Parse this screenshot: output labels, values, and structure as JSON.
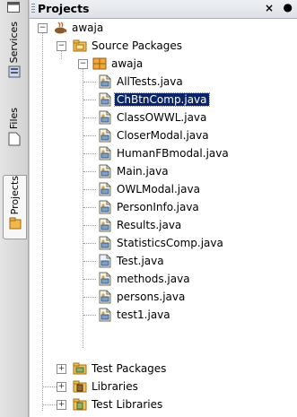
{
  "strip": {
    "tabs": [
      {
        "label": "Services",
        "icon": "services-icon"
      },
      {
        "label": "Files",
        "icon": "files-icon"
      },
      {
        "label": "Projects",
        "icon": "projects-icon"
      }
    ]
  },
  "panel": {
    "title": "Projects",
    "close_label": "×",
    "minimize_label": "●"
  },
  "tree": {
    "project": "awaja",
    "source_packages": "Source Packages",
    "package": "awaja",
    "files": [
      "AllTests.java",
      "ChBtnComp.java",
      "ClassOWWL.java",
      "CloserModal.java",
      "HumanFBmodal.java",
      "Main.java",
      "OWLModal.java",
      "PersonInfo.java",
      "Results.java",
      "StatisticsComp.java",
      "Test.java",
      "methods.java",
      "persons.java",
      "test1.java"
    ],
    "selected_file": "ChBtnComp.java",
    "test_packages": "Test Packages",
    "libraries": "Libraries",
    "test_libraries": "Test Libraries"
  },
  "colors": {
    "selection": "#0a246a",
    "folder": "#e8b34a",
    "package": "#e7a23a"
  }
}
